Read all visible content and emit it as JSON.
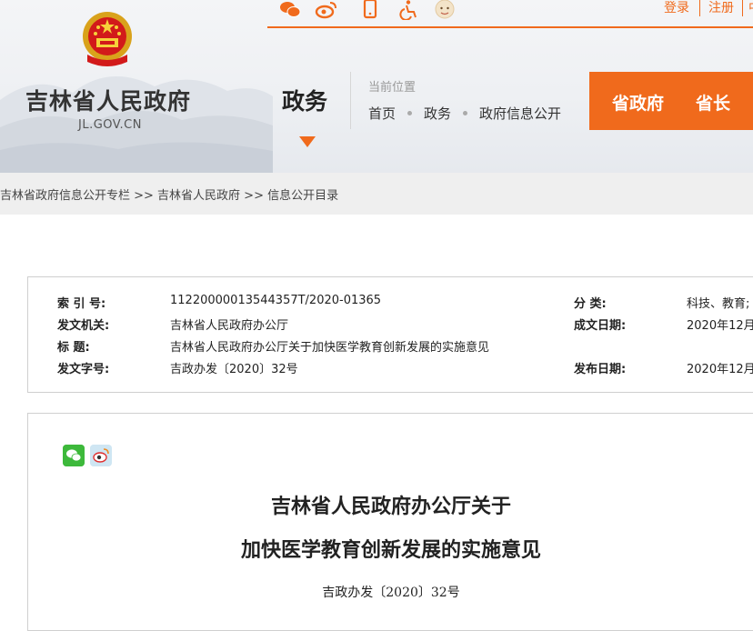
{
  "header": {
    "site_name": "吉林省人民政府",
    "site_domain": "JL.GOV.CN",
    "section_title": "政务",
    "location_label": "当前位置",
    "breadcrumb": [
      "首页",
      "政务",
      "政府信息公开"
    ],
    "nav_buttons": [
      "省政府",
      "省长"
    ],
    "top_links": [
      "登录",
      "注册",
      "中"
    ],
    "top_icons": [
      "wechat-icon",
      "weibo-icon",
      "mobile-icon",
      "accessibility-icon",
      "elder-mode-icon"
    ],
    "accent_color": "#f06a1c"
  },
  "crumb_bar": {
    "text": "吉林省政府信息公开专栏 >> 吉林省人民政府 >> 信息公开目录"
  },
  "info": {
    "index_label": "索 引 号:",
    "index_value": "11220000013544357T/2020-01365",
    "category_label": "分 类:",
    "category_value": "科技、教育;",
    "issuer_label": "发文机关:",
    "issuer_value": "吉林省人民政府办公厅",
    "created_label": "成文日期:",
    "created_value": "2020年12月",
    "title_label": "标 题:",
    "title_value": "吉林省人民政府办公厅关于加快医学教育创新发展的实施意见",
    "docno_label": "发文字号:",
    "docno_value": "吉政办发〔2020〕32号",
    "published_label": "发布日期:",
    "published_value": "2020年12月"
  },
  "article": {
    "share_icons": [
      "wechat-icon",
      "weibo-icon"
    ],
    "title_line1": "吉林省人民政府办公厅关于",
    "title_line2": "加快医学教育创新发展的实施意见",
    "doc_number": "吉政办发〔2020〕32号"
  }
}
